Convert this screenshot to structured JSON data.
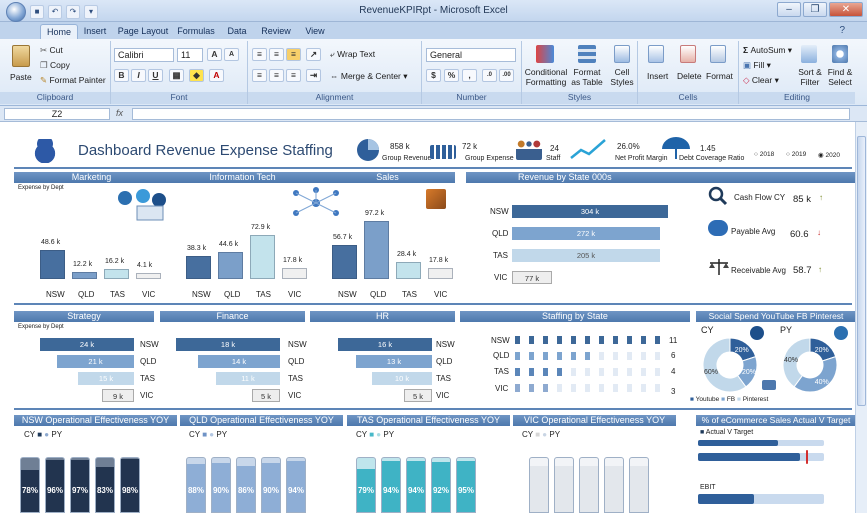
{
  "window": {
    "title": "RevenueKPIRpt - Microsoft Excel"
  },
  "tabs": [
    "Home",
    "Insert",
    "Page Layout",
    "Formulas",
    "Data",
    "Review",
    "View"
  ],
  "ribbon": {
    "clipboard": {
      "paste": "Paste",
      "cut": "Cut",
      "copy": "Copy",
      "format_painter": "Format Painter",
      "label": "Clipboard"
    },
    "font": {
      "name": "Calibri",
      "size": "11",
      "label": "Font"
    },
    "alignment": {
      "wrap": "Wrap Text",
      "merge": "Merge & Center",
      "label": "Alignment"
    },
    "number": {
      "format": "General",
      "label": "Number"
    },
    "styles": {
      "cond": "Conditional Formatting",
      "table": "Format as Table",
      "cell": "Cell Styles",
      "label": "Styles"
    },
    "cells": {
      "insert": "Insert",
      "delete": "Delete",
      "format": "Format",
      "label": "Cells"
    },
    "editing": {
      "autosum": "AutoSum",
      "fill": "Fill",
      "clear": "Clear",
      "sort": "Sort & Filter",
      "find": "Find & Select",
      "label": "Editing"
    }
  },
  "formula_bar": {
    "name_box": "Z2",
    "fx": "fx"
  },
  "dashboard": {
    "title": "Dashboard Revenue Expense Staffing",
    "kpis": {
      "group_revenue": {
        "value": "858 k",
        "label": "Group Revenue"
      },
      "group_expense": {
        "value": "72 k",
        "label": "Group Expense"
      },
      "staff": {
        "value": "24",
        "label": "Staff"
      },
      "net_profit": {
        "value": "26.0%",
        "label": "Net Profit Margin"
      },
      "debt": {
        "value": "1.45",
        "label": "Debt Coverage Ratio"
      }
    },
    "years": [
      "2018",
      "2019",
      "2020"
    ],
    "sections": {
      "marketing": "Marketing",
      "it": "Information Tech",
      "sales": "Sales",
      "revenue_state": "Revenue by State 000s",
      "strategy": "Strategy",
      "finance": "Finance",
      "hr": "HR",
      "staffing_state": "Staffing by State",
      "social": "Social Spend YouTube FB Pinterest",
      "nsw_op": "NSW Operational Effectiveness YOY",
      "qld_op": "QLD Operational Effectiveness YOY",
      "tas_op": "TAS Operational Effectiveness YOY",
      "vic_op": "VIC Operational Effectiveness YOY",
      "ecom": "% of eCommerce Sales Actual V Target"
    },
    "expense_by_dept": "Expense by Dept",
    "states": [
      "NSW",
      "QLD",
      "TAS",
      "VIC"
    ],
    "marketing_vals": [
      "48.6 k",
      "12.2 k",
      "16.2 k",
      "4.1 k"
    ],
    "it_vals": [
      "38.3 k",
      "44.6 k",
      "72.9 k",
      "17.8 k"
    ],
    "sales_vals": [
      "56.7 k",
      "97.2 k",
      "28.4 k",
      "17.8 k"
    ],
    "revenue_state_vals": [
      "304 k",
      "272 k",
      "205 k",
      "77 k"
    ],
    "cash_flow": {
      "label": "Cash Flow CY",
      "value": "85 k",
      "trend": "↑"
    },
    "payable": {
      "label": "Payable Avg",
      "value": "60.6",
      "trend": "↓"
    },
    "receivable": {
      "label": "Receivable Avg",
      "value": "58.7",
      "trend": "↑"
    },
    "strategy_vals": [
      "24 k",
      "21 k",
      "15 k",
      "9 k"
    ],
    "finance_vals": [
      "18 k",
      "14 k",
      "11 k",
      "5 k"
    ],
    "hr_vals": [
      "16 k",
      "13 k",
      "10 k",
      "5 k"
    ],
    "staff_counts": [
      "11",
      "6",
      "4",
      "3"
    ],
    "social": {
      "cy": "CY",
      "py": "PY",
      "cy_pcts": [
        "20%",
        "20%",
        "60%"
      ],
      "py_pcts": [
        "20%",
        "40%",
        "40%"
      ],
      "legend": [
        "Youtube",
        "FB",
        "Pinterest"
      ]
    },
    "cy": "CY",
    "py": "PY",
    "nsw_pcts": [
      "78%",
      "96%",
      "97%",
      "83%",
      "98%"
    ],
    "qld_pcts": [
      "88%",
      "90%",
      "86%",
      "90%",
      "94%"
    ],
    "tas_pcts": [
      "79%",
      "94%",
      "94%",
      "92%",
      "95%"
    ],
    "ecom_labels": [
      "Actual V Target",
      "EBIT"
    ]
  },
  "colors": {
    "accent": "#4d78ad",
    "dark": "#2f4f7f",
    "light": "#9fc3dc",
    "teal": "#49b9c9"
  }
}
